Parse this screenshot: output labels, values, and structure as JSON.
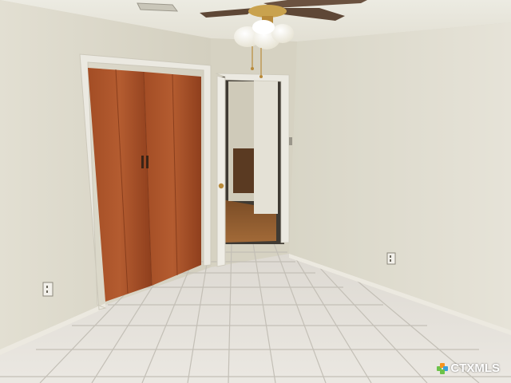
{
  "watermark": {
    "text": "CTXMLS",
    "colors": [
      "#6cc24a",
      "#f7941d",
      "#3aa0dc"
    ]
  },
  "palette": {
    "wall_left": "#dcd9cb",
    "wall_right": "#e0ddd0",
    "ceiling": "#e9e7dc",
    "floor": "#e4e1da",
    "grout": "#b9b5ad",
    "closet_wood": "#9c4a24",
    "hall_floor": "#8a5a2e",
    "trim": "#ebe9e1"
  }
}
